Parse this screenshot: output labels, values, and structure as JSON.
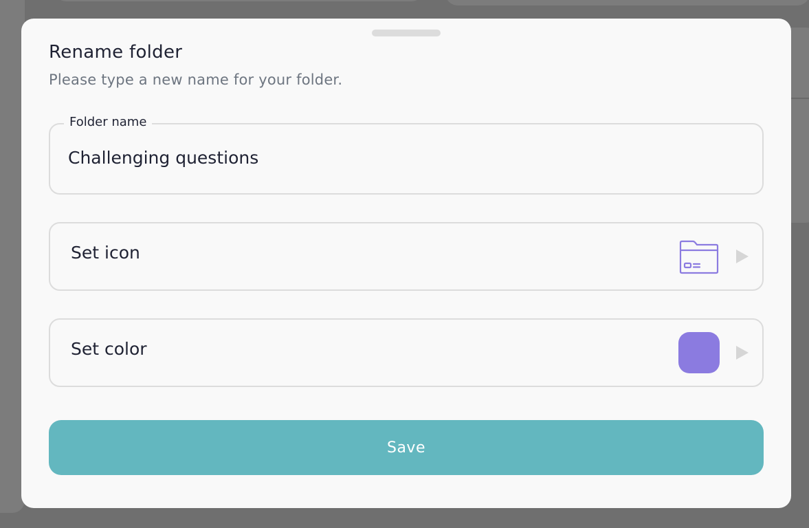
{
  "dialog": {
    "title": "Rename folder",
    "subtitle": "Please type a new name for your folder."
  },
  "folder_name_field": {
    "label": "Folder name",
    "value": "Challenging questions"
  },
  "set_icon": {
    "label": "Set icon",
    "icon": "folder-card-icon",
    "icon_color": "#8b7be0"
  },
  "set_color": {
    "label": "Set color",
    "selected_color": "#8b7be0"
  },
  "save_button": {
    "label": "Save",
    "color": "#63b7bf"
  }
}
